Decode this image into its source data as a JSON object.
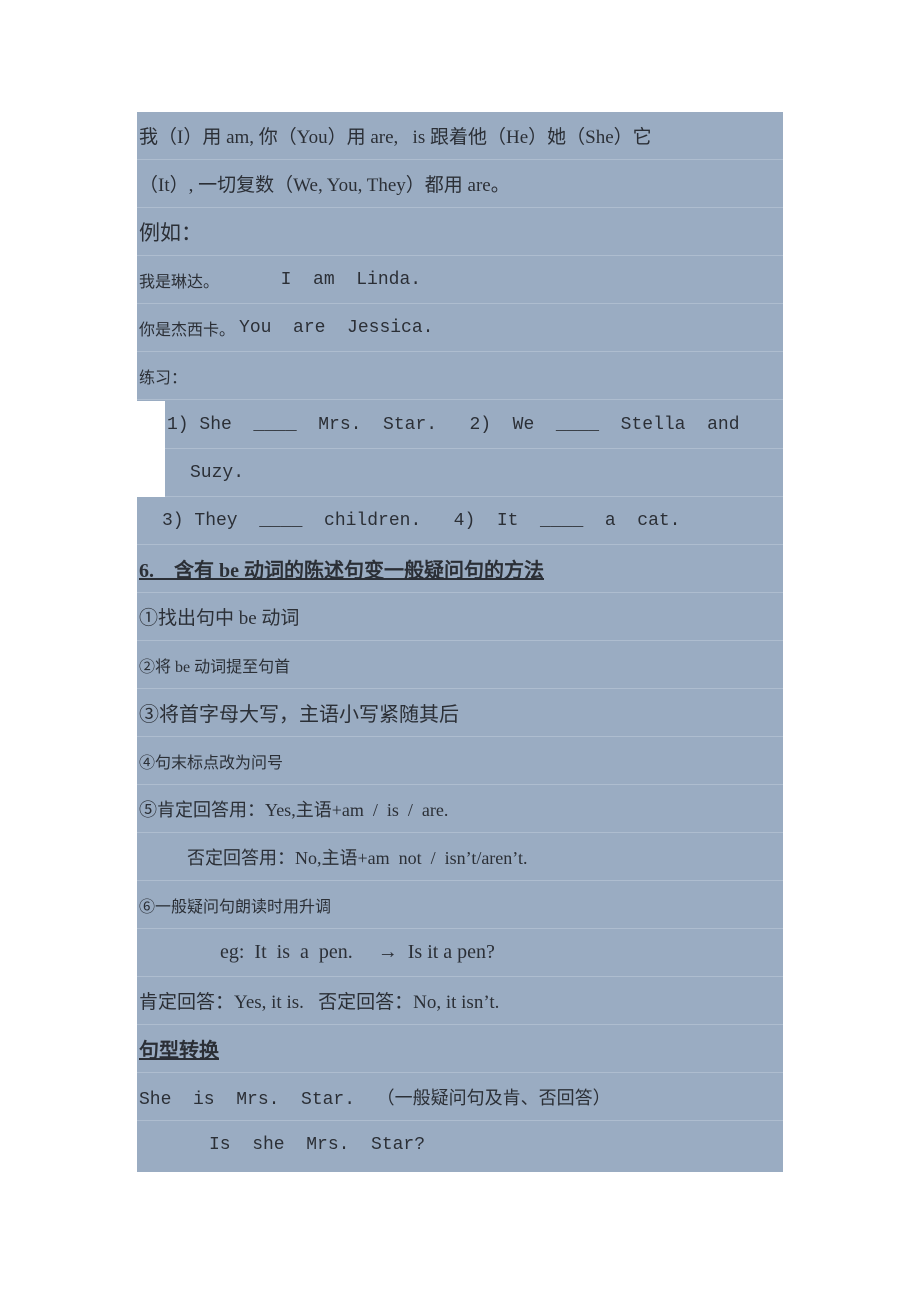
{
  "rules": {
    "line1": "我（I）用 am, 你（You）用 are,   is 跟着他（He）她（She）它",
    "line2": "（It）, 一切复数（We, You, They）都用 are。"
  },
  "examples": {
    "label": "例如：",
    "ex1_cn": "我是琳达。",
    "ex1_en": "  I  am  Linda.",
    "ex2_cn": "你是杰西卡。",
    "ex2_en": "You  are  Jessica."
  },
  "practice": {
    "label": "练习：",
    "q1_2_line1": "1) She  ____  Mrs.  Star.   2)  We  ____  Stella  and",
    "q1_2_line2": "Suzy.",
    "q3_4": "3) They  ____  children.   4)  It  ____  a  cat."
  },
  "section6": {
    "heading": "6.    含有 be 动词的陈述句变一般疑问句的方法",
    "step1": "①找出句中 be 动词",
    "step2": "②将 be 动词提至句首",
    "step3": "③将首字母大写，主语小写紧随其后",
    "step4": "④句末标点改为问号",
    "step5_pos": "⑤肯定回答用：Yes,主语+am  /  is  /  are.",
    "step5_neg": "否定回答用：No,主语+am  not  /  isn’t/aren’t.",
    "step6": "⑥一般疑问句朗读时用升调",
    "eg": "eg:  It  is  a  pen.     →  Is it a pen?",
    "answers": "肯定回答：Yes, it is.   否定回答：No, it isn’t."
  },
  "transform": {
    "heading": "句型转换",
    "prompt": "She  is  Mrs.  Star.  （一般疑问句及肯、否回答）",
    "answer": "Is  she  Mrs.  Star?"
  }
}
